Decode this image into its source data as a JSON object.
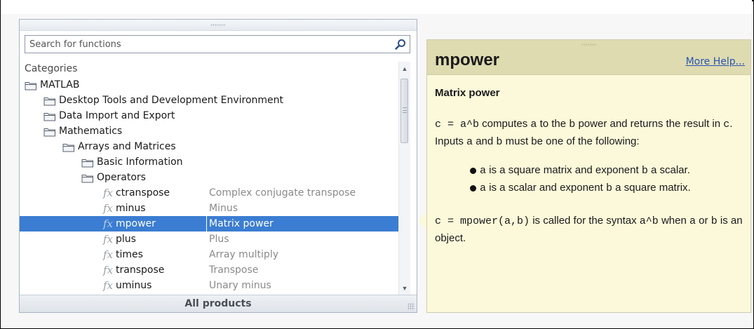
{
  "browser": {
    "search_placeholder": "Search for functions",
    "categories_header": "Categories",
    "tree": [
      {
        "level": 0,
        "kind": "folder",
        "label": "MATLAB"
      },
      {
        "level": 1,
        "kind": "folder",
        "label": "Desktop Tools and Development Environment"
      },
      {
        "level": 1,
        "kind": "folder",
        "label": "Data Import and Export"
      },
      {
        "level": 1,
        "kind": "folder",
        "label": "Mathematics"
      },
      {
        "level": 2,
        "kind": "folder",
        "label": "Arrays and Matrices"
      },
      {
        "level": 3,
        "kind": "folder",
        "label": "Basic Information"
      },
      {
        "level": 3,
        "kind": "folder",
        "label": "Operators"
      },
      {
        "level": 4,
        "kind": "function",
        "label": "ctranspose",
        "desc": "Complex conjugate transpose"
      },
      {
        "level": 4,
        "kind": "function",
        "label": "minus",
        "desc": "Minus"
      },
      {
        "level": 4,
        "kind": "function",
        "label": "mpower",
        "desc": "Matrix power",
        "selected": true
      },
      {
        "level": 4,
        "kind": "function",
        "label": "plus",
        "desc": "Plus"
      },
      {
        "level": 4,
        "kind": "function",
        "label": "times",
        "desc": "Array multiply"
      },
      {
        "level": 4,
        "kind": "function",
        "label": "transpose",
        "desc": "Transpose"
      },
      {
        "level": 4,
        "kind": "function",
        "label": "uminus",
        "desc": "Unary minus"
      }
    ],
    "fx_glyph": "fx",
    "footer_label": "All products"
  },
  "help": {
    "title": "mpower",
    "more_help": "More Help...",
    "subtitle": "Matrix power",
    "p1": {
      "code1": "c = a^b",
      "t1": " computes ",
      "code2": "a",
      "t2": " to the ",
      "code3": "b",
      "t3": " power and returns the result in ",
      "code4": "c",
      "t4": ". Inputs ",
      "code5": "a",
      "t5": " and ",
      "code6": "b",
      "t6": " must be one of the following:"
    },
    "bullets": [
      {
        "code": "a",
        "text": " is a square matrix and exponent ",
        "code2": "b",
        "text2": " a scalar."
      },
      {
        "code": "a",
        "text": " is a scalar and exponent ",
        "code2": "b",
        "text2": " a square matrix."
      }
    ],
    "p2": {
      "code1": "c = mpower(a,b)",
      "t1": " is called for the syntax ",
      "code2": "a^b",
      "t2": " when ",
      "code3": "a",
      "t3": " or ",
      "code4": "b",
      "t4": " is an object."
    }
  },
  "colors": {
    "selection": "#3b7dd2",
    "help_background": "#fbf9da",
    "help_header": "#dedbb0",
    "link": "#2a55b0"
  }
}
